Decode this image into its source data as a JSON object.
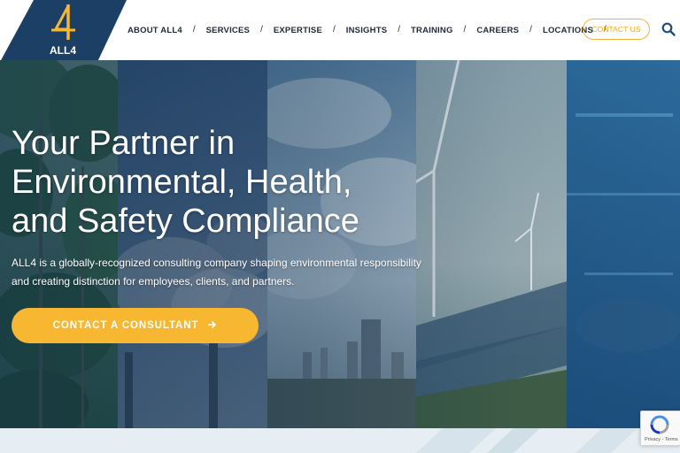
{
  "header": {
    "logo_text": "ALL4",
    "nav": [
      {
        "label": "ABOUT ALL4"
      },
      {
        "label": "SERVICES"
      },
      {
        "label": "EXPERTISE"
      },
      {
        "label": "INSIGHTS"
      },
      {
        "label": "TRAINING"
      },
      {
        "label": "CAREERS"
      },
      {
        "label": "LOCATIONS"
      }
    ],
    "nav_separator": "/",
    "contact_label": "CONTACT US",
    "search_icon": "search-icon"
  },
  "hero": {
    "title_lines": [
      "Your Partner in",
      "Environmental, Health,",
      "and Safety Compliance"
    ],
    "subtitle_lines": [
      "ALL4 is a globally-recognized consulting company shaping environmental responsibility",
      "and creating distinction for employees, clients, and partners."
    ],
    "cta_label": "CONTACT A CONSULTANT",
    "cta_icon": "arrow-right-icon"
  },
  "recaptcha": {
    "terms": "Privacy - Terms",
    "icon": "recaptcha-icon"
  },
  "colors": {
    "brand_navy": "#1c3f66",
    "brand_gold": "#f7b731",
    "nav_text": "#1f2a38"
  }
}
